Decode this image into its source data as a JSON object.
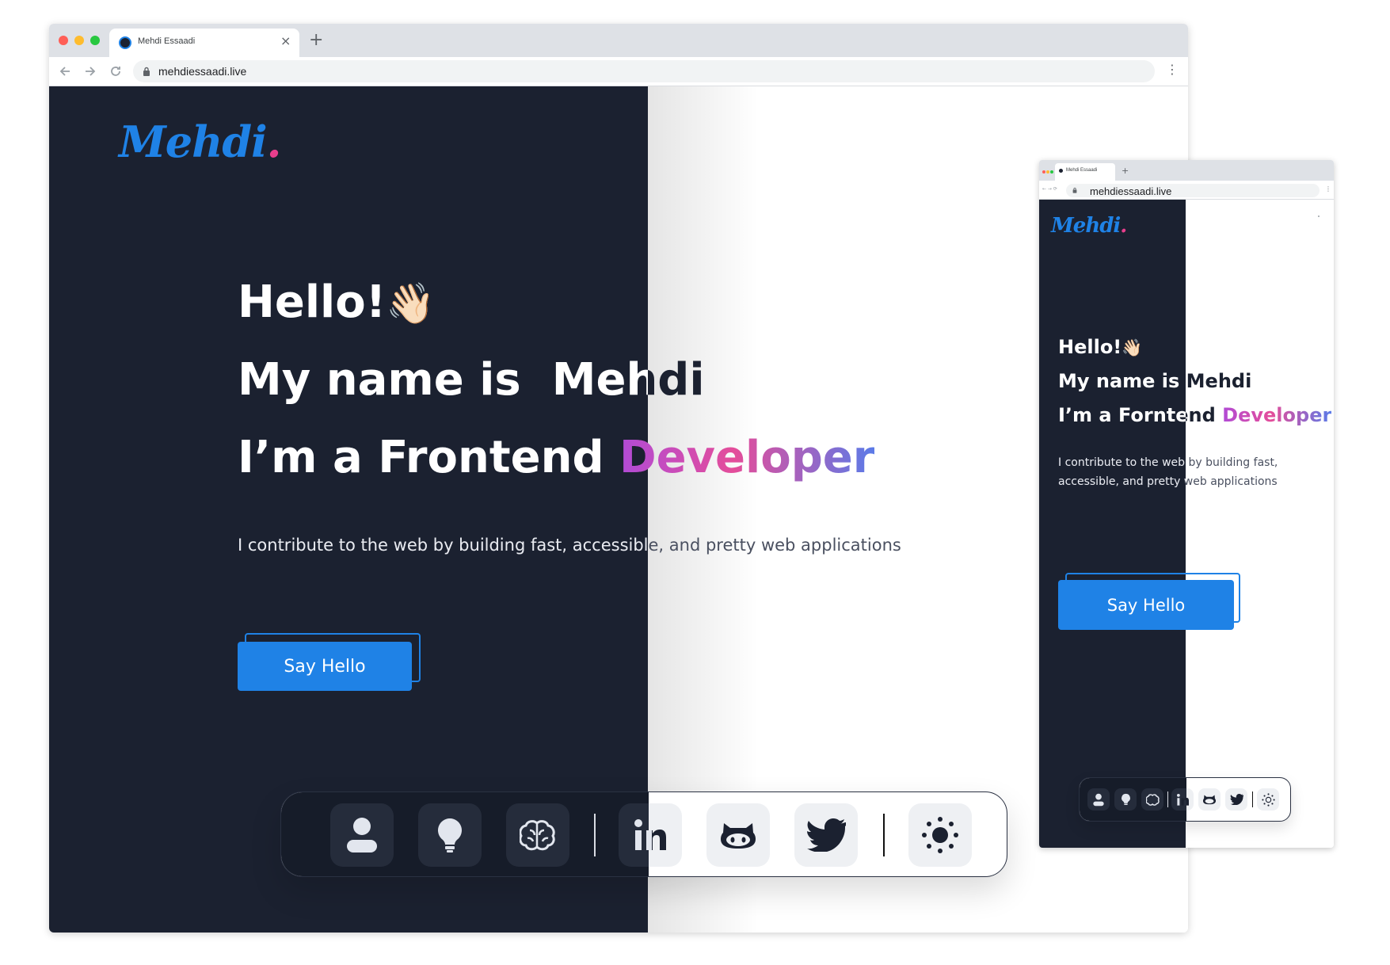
{
  "browser": {
    "tab_title": "Mehdi Essaadi",
    "url": "mehdiessaadi.live",
    "new_tab_symbol": "+",
    "close_symbol": "×",
    "menu_symbol": "⋮"
  },
  "site": {
    "logo_text": "Mehdi",
    "logo_dot": ".",
    "desktop": {
      "hello": "Hello!",
      "wave_emoji": "👋🏻",
      "name_line": "My name is  Mehdi",
      "role_prefix": "I’m a Frontend ",
      "role_highlight": "Developer",
      "description": "I contribute to the web by building fast, accessible, and pretty web applications",
      "cta_label": "Say Hello"
    },
    "mobile": {
      "hello": "Hello!",
      "wave_emoji": "👋🏻",
      "name_line": "My name is Mehdi",
      "role_prefix": "I’m a Forntend ",
      "role_highlight": "Developer",
      "description": "I contribute to the web by building fast, accessible, and pretty web applications",
      "cta_label": "Say Hello"
    }
  },
  "dock": {
    "icons": [
      "person-icon",
      "lightbulb-icon",
      "brain-icon",
      "linkedin-icon",
      "github-icon",
      "twitter-icon",
      "sun-icon"
    ]
  },
  "colors": {
    "dark_bg": "#1b2130",
    "accent": "#1f82e6",
    "gradient_start": "#b14bd6",
    "gradient_mid": "#e44d9a",
    "gradient_end": "#5b7be8"
  }
}
